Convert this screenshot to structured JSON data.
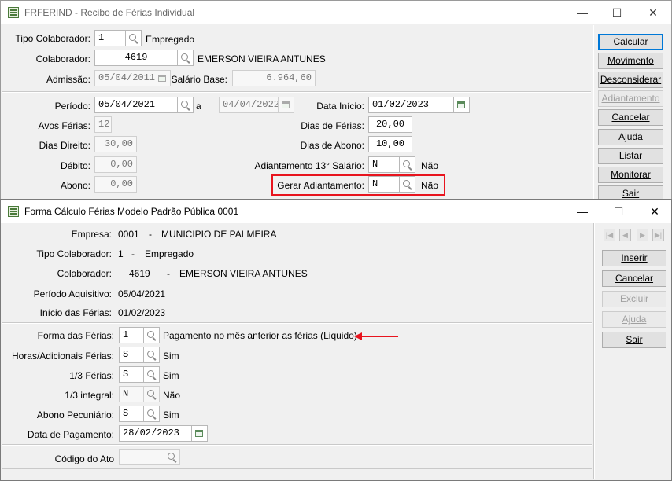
{
  "back_window": {
    "title": "FRFERIND - Recibo de Férias Individual",
    "tipo_colaborador": {
      "label": "Tipo Colaborador:",
      "value": "1",
      "desc": "Empregado"
    },
    "colaborador": {
      "label": "Colaborador:",
      "value": "4619",
      "name": "EMERSON VIEIRA ANTUNES"
    },
    "admissao": {
      "label": "Admissão:",
      "value": "05/04/2011"
    },
    "salario_base": {
      "label": "Salário Base:",
      "value": "6.964,60"
    },
    "periodo": {
      "label": "Período:",
      "start": "05/04/2021",
      "sep": "a",
      "end": "04/04/2022"
    },
    "data_inicio": {
      "label": "Data Início:",
      "value": "01/02/2023"
    },
    "avos_ferias": {
      "label": "Avos Férias:",
      "value": "12"
    },
    "dias_ferias": {
      "label": "Dias de Férias:",
      "value": "20,00"
    },
    "dias_direito": {
      "label": "Dias Direito:",
      "value": "30,00"
    },
    "dias_abono": {
      "label": "Dias de Abono:",
      "value": "10,00"
    },
    "debito": {
      "label": "Débito:",
      "value": "0,00"
    },
    "adiantamento_13": {
      "label": "Adiantamento 13° Salário:",
      "value": "N",
      "desc": "Não"
    },
    "abono": {
      "label": "Abono:",
      "value": "0,00"
    },
    "gerar_adiantamento": {
      "label": "Gerar Adiantamento:",
      "value": "N",
      "desc": "Não"
    },
    "buttons": [
      "Calcular",
      "Movimento",
      "Desconsiderar",
      "Adiantamento",
      "Cancelar",
      "Ajuda",
      "Listar",
      "Monitorar",
      "Sair"
    ]
  },
  "front_window": {
    "title": "Forma Cálculo Férias Modelo Padrão Pública 0001",
    "empresa": {
      "label": "Empresa:",
      "code": "0001",
      "dash": "-",
      "name": "MUNICIPIO DE PALMEIRA"
    },
    "tipo_colaborador": {
      "label": "Tipo Colaborador:",
      "code": "1",
      "dash": "-",
      "name": "Empregado"
    },
    "colaborador": {
      "label": "Colaborador:",
      "code": "4619",
      "dash": "-",
      "name": "EMERSON VIEIRA ANTUNES"
    },
    "periodo_aquisitivo": {
      "label": "Período Aquisitivo:",
      "value": "05/04/2021"
    },
    "inicio_ferias": {
      "label": "Início das Férias:",
      "value": "01/02/2023"
    },
    "forma_ferias": {
      "label": "Forma das Férias:",
      "value": "1",
      "desc": "Pagamento no mês anterior as férias (Liquido)"
    },
    "horas_adicionais": {
      "label": "Horas/Adicionais Férias:",
      "value": "S",
      "desc": "Sim"
    },
    "um_terco_ferias": {
      "label": "1/3 Férias:",
      "value": "S",
      "desc": "Sim"
    },
    "um_terco_integral": {
      "label": "1/3 integral:",
      "value": "N",
      "desc": "Não"
    },
    "abono_pecuniario": {
      "label": "Abono Pecuniário:",
      "value": "S",
      "desc": "Sim"
    },
    "data_pagamento": {
      "label": "Data de Pagamento:",
      "value": "28/02/2023"
    },
    "codigo_ato": {
      "label": "Código do Ato",
      "value": ""
    },
    "buttons": [
      "Inserir",
      "Cancelar",
      "Excluir",
      "Ajuda",
      "Sair"
    ]
  },
  "colors": {
    "highlight": "#e8141e",
    "arrow": "#e8141e",
    "default_button": "#0078d7"
  }
}
